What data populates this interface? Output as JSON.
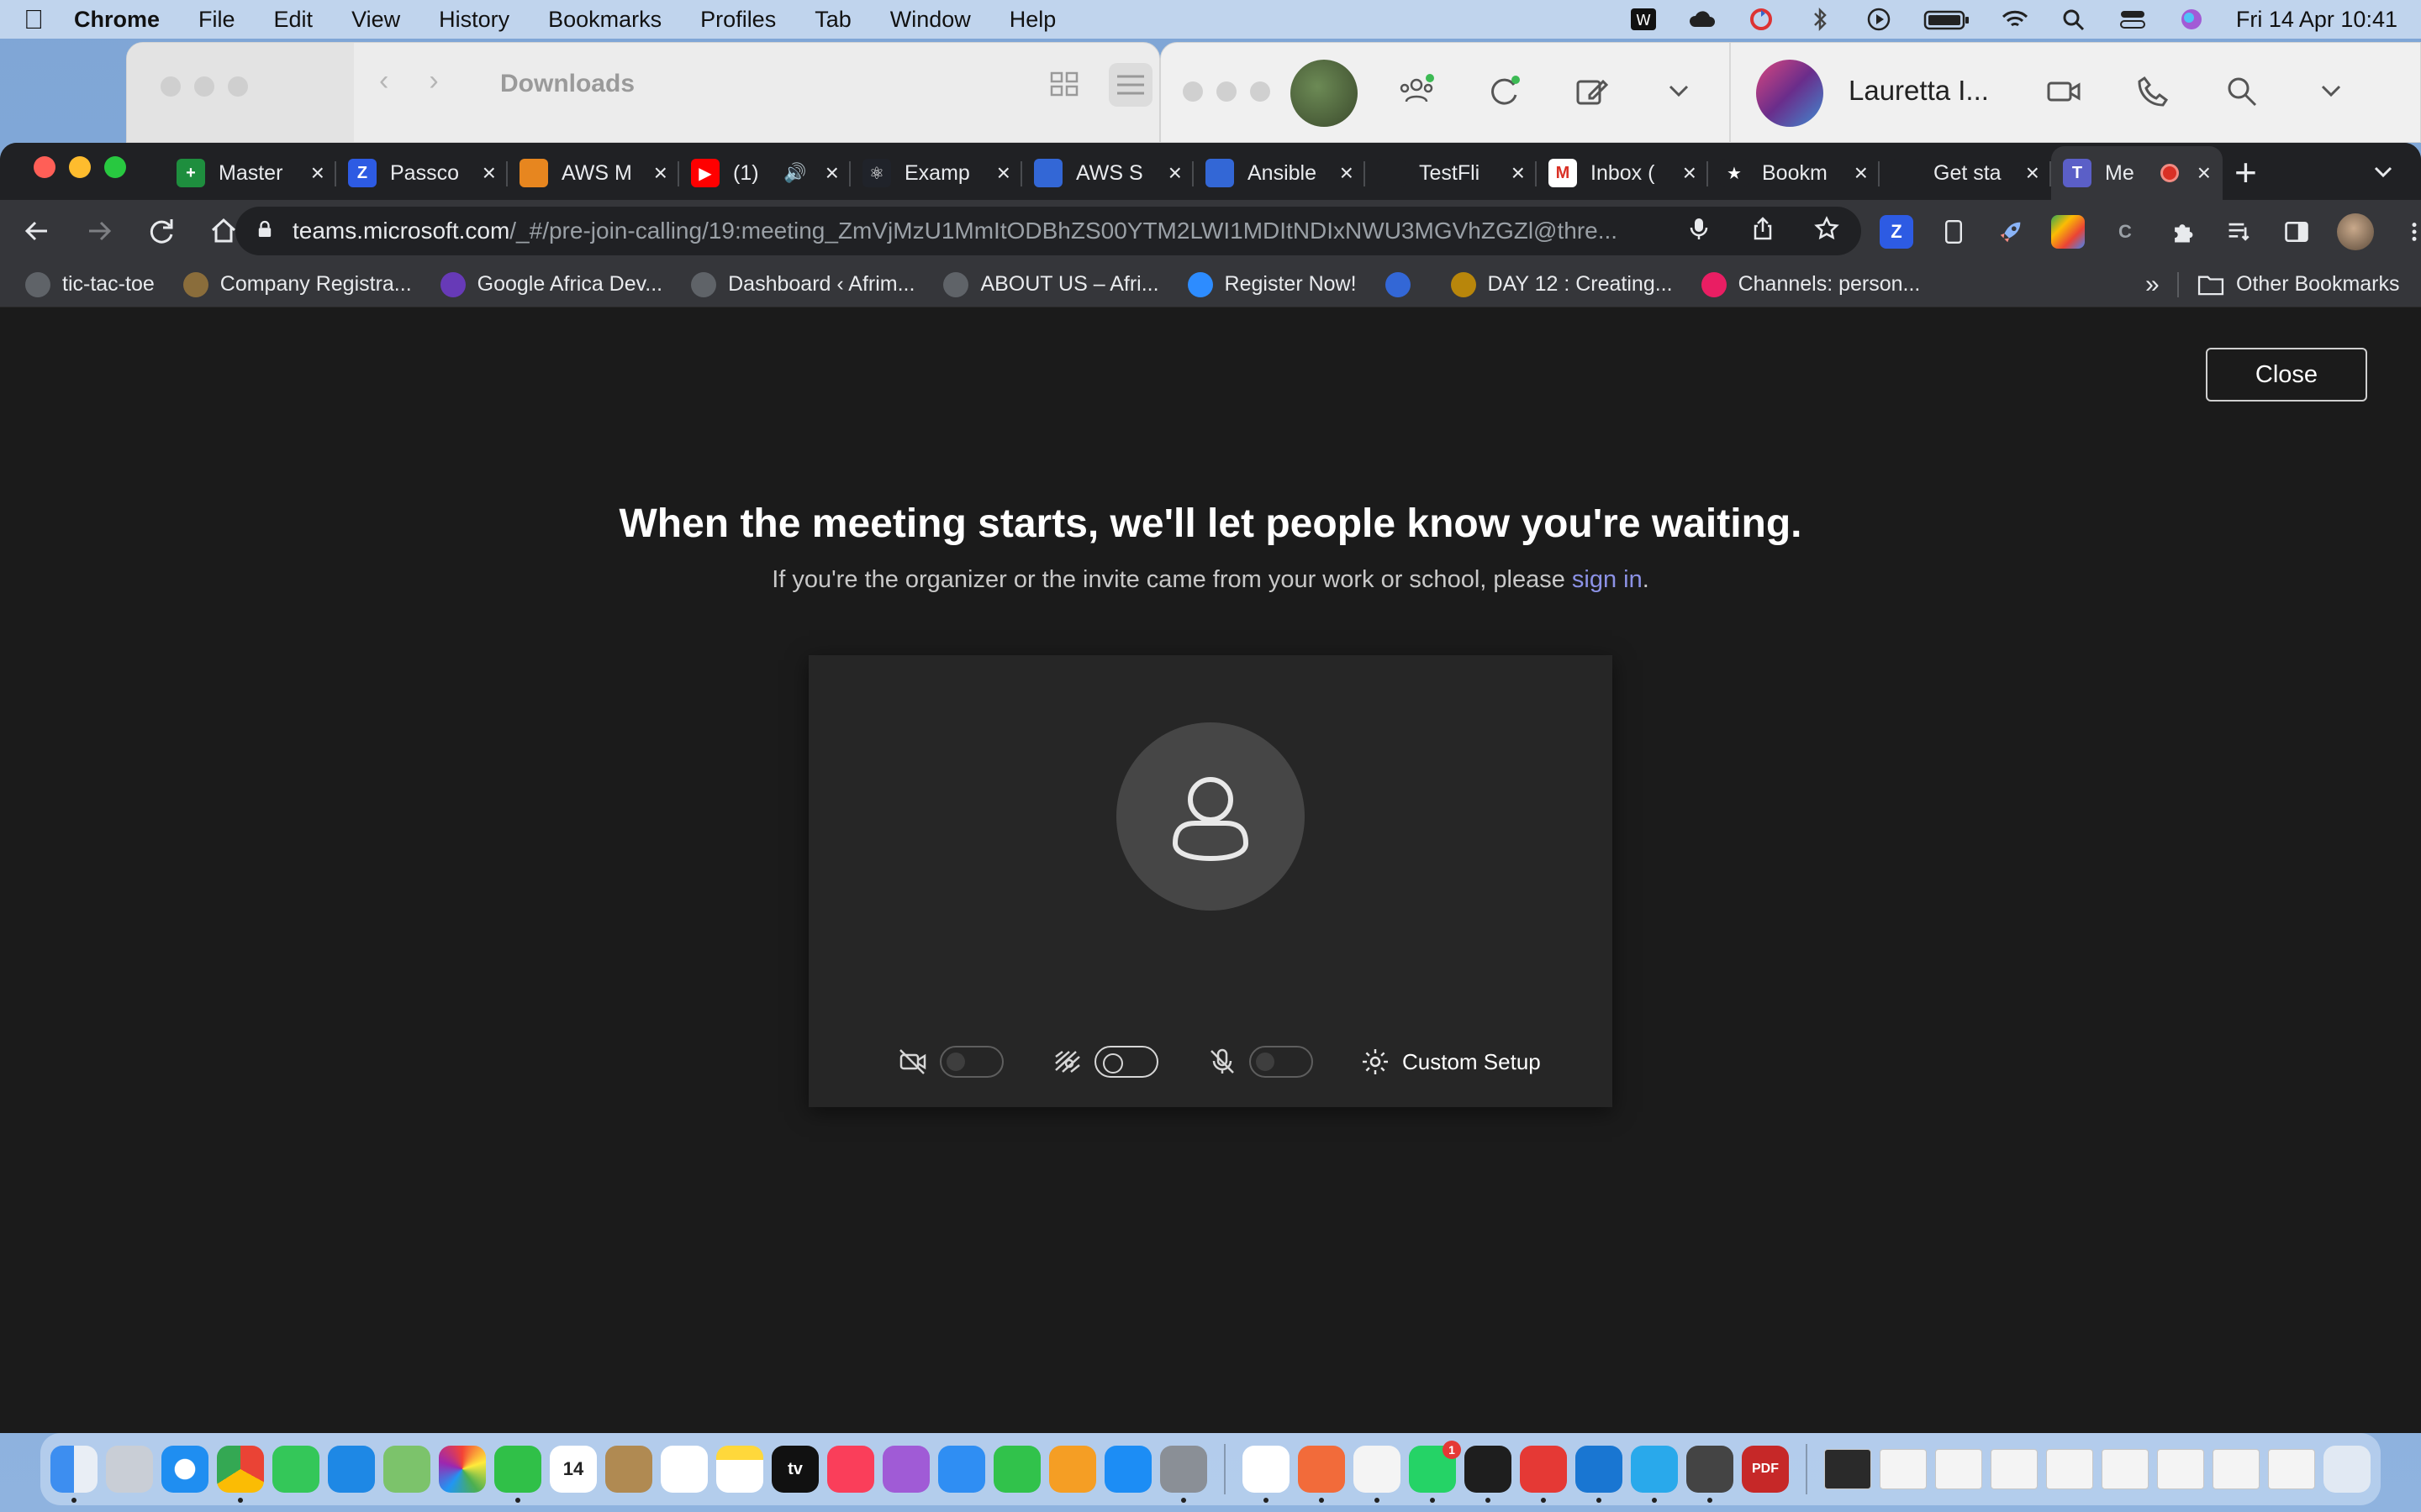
{
  "menubar": {
    "app_name": "Chrome",
    "items": [
      "File",
      "Edit",
      "View",
      "History",
      "Bookmarks",
      "Profiles",
      "Tab",
      "Window",
      "Help"
    ],
    "clock": "Fri 14 Apr  10:41"
  },
  "finder": {
    "title": "Downloads"
  },
  "teams_app": {
    "contact_name": "Lauretta I..."
  },
  "tabs": [
    {
      "label": "Master",
      "favicon_color": "#1e8e3e",
      "glyph": "+"
    },
    {
      "label": "Passco",
      "favicon_color": "#2d5be3",
      "glyph": "Z"
    },
    {
      "label": "AWS M",
      "favicon_color": "#e7861f",
      "glyph": ""
    },
    {
      "label": "(1)",
      "favicon_color": "#ff0000",
      "glyph": "▶"
    },
    {
      "label": "Examp",
      "favicon_color": "#20232a",
      "glyph": "⚛"
    },
    {
      "label": "AWS S",
      "favicon_color": "#3367d6",
      "glyph": ""
    },
    {
      "label": "Ansible",
      "favicon_color": "#3367d6",
      "glyph": ""
    },
    {
      "label": "TestFli",
      "favicon_color": "#202124",
      "glyph": ""
    },
    {
      "label": "Inbox (",
      "favicon_color": "#ffffff",
      "glyph": "M"
    },
    {
      "label": "Bookm",
      "favicon_color": "#202124",
      "glyph": "★"
    },
    {
      "label": "Get sta",
      "favicon_color": "#202124",
      "glyph": ""
    },
    {
      "label": "Me",
      "favicon_color": "#5b5fc7",
      "glyph": "T"
    }
  ],
  "omnibox": {
    "url_host": "teams.microsoft.com",
    "url_path": "/_#/pre-join-calling/19:meeting_ZmVjMzU1MmItODBhZS00YTM2LWI1MDItNDIxNWU3MGVhZGZl@thre..."
  },
  "bookmarks": [
    {
      "label": "tic-tac-toe",
      "color": "#5f6368"
    },
    {
      "label": "Company Registra...",
      "color": "#8a6d3b"
    },
    {
      "label": "Google Africa Dev...",
      "color": "#673ab7"
    },
    {
      "label": "Dashboard ‹ Afrim...",
      "color": "#5f6368"
    },
    {
      "label": "ABOUT US – Afri...",
      "color": "#5f6368"
    },
    {
      "label": "Register Now!",
      "color": "#2d8cff"
    },
    {
      "label": "",
      "color": "#3367d6"
    },
    {
      "label": "DAY 12 : Creating...",
      "color": "#b8860b"
    },
    {
      "label": "Channels: person...",
      "color": "#e91e63"
    }
  ],
  "bookmarks_more": "»",
  "bookmarks_other": "Other Bookmarks",
  "page": {
    "close_label": "Close",
    "headline": "When the meeting starts, we'll let people know you're waiting.",
    "subline_prefix": "If you're the organizer or the invite came from your work or school, please ",
    "signin_link": "sign in",
    "subline_suffix": ".",
    "custom_setup_label": "Custom Setup"
  },
  "dock": {
    "calendar_day": "14",
    "whatsapp_badge": "1",
    "pdf_label": "PDF",
    "tv_label": "tv"
  },
  "colors": {
    "page_bg": "#1b1b1b",
    "link": "#8c92e6",
    "chrome_toolbar": "#35363a"
  }
}
